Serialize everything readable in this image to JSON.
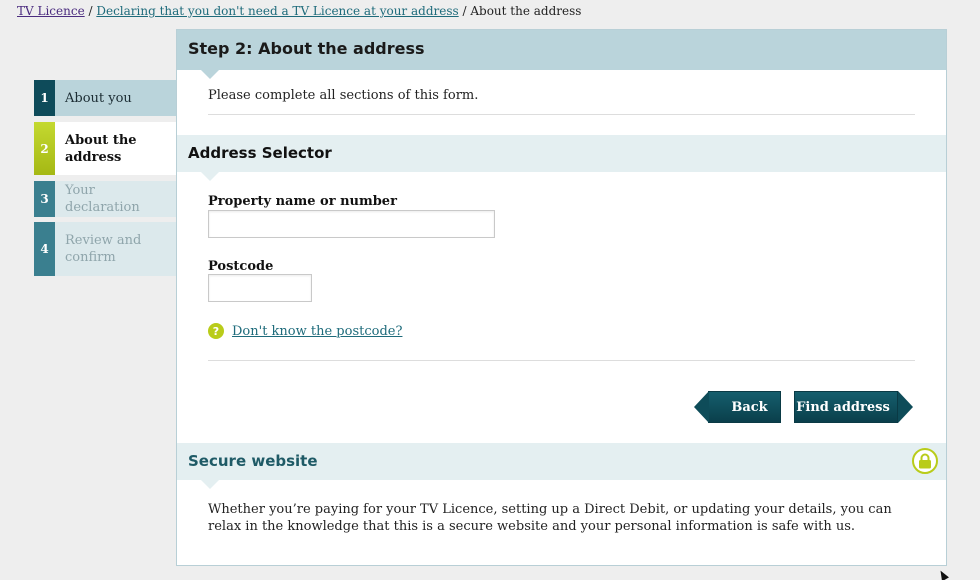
{
  "breadcrumb": {
    "home": "TV Licence",
    "sep1": " / ",
    "parent": "Declaring that you don't need a TV Licence at your address",
    "sep2": " / ",
    "current": "About the address"
  },
  "steps": [
    {
      "num": "1",
      "label": "About you",
      "state": "complete"
    },
    {
      "num": "2",
      "label": "About the address",
      "state": "current"
    },
    {
      "num": "3",
      "label": "Your declaration",
      "state": "upcoming"
    },
    {
      "num": "4",
      "label": "Review and confirm",
      "state": "upcoming"
    }
  ],
  "main": {
    "step_title": "Step 2: About the address",
    "intro": "Please complete all sections of this form.",
    "section_title": "Address Selector",
    "fields": {
      "property_label": "Property name or number",
      "property_value": "",
      "postcode_label": "Postcode",
      "postcode_value": ""
    },
    "help_icon_glyph": "?",
    "help_link": "Don't know the postcode?",
    "back_button": "Back",
    "find_button": "Find address"
  },
  "secure": {
    "title": "Secure website",
    "text": "Whether you’re paying for your TV Licence, setting up a Direct Debit, or updating your details, you can relax in the knowledge that this is a secure website and your personal information is safe with us.",
    "icon": "lock-icon"
  },
  "colors": {
    "brand_dark": "#0e4b5a",
    "accent_green": "#b9cc1a",
    "header_blue": "#bad4db",
    "section_blue": "#e4eff1"
  }
}
